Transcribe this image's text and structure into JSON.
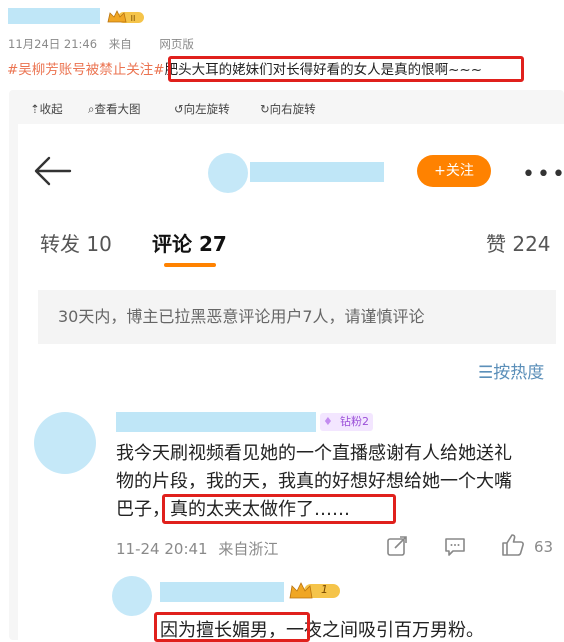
{
  "post": {
    "date": "11月24日 21:46",
    "source": "来自",
    "platform": "网页版",
    "hashtag": "#吴柳芳账号被禁止关注#",
    "text": "肥头大耳的姥妹们对长得好看的女人是真的恨啊~~~"
  },
  "toolbar": {
    "collapse": "收起",
    "view_large": "查看大图",
    "rotate_left": "向左旋转",
    "rotate_right": "向右旋转"
  },
  "screenshot": {
    "follow_label": "+关注",
    "tabs": [
      {
        "label": "转发 10"
      },
      {
        "label": "评论 27"
      },
      {
        "label": "赞 224"
      }
    ],
    "notice": "30天内，博主已拉黑恶意评论用户7人，请谨慎评论",
    "sort_label": "按热度",
    "comment": {
      "badge": "钻粉2",
      "text_line1": "我今天刷视频看见她的一个直播感谢有人给她送礼",
      "text_line2": "物的片段，我的天，我真的好想好想给她一个大嘴",
      "text_line3_pre": "巴子，",
      "text_line3_highlight": "真的太夹太做作了……",
      "timestamp": "11-24 20:41",
      "location": "来自浙江",
      "like_count": "63"
    },
    "reply": {
      "badge_level": "1",
      "text_highlight": "因为擅长媚男，",
      "text_rest": "一夜之间吸引百万男粉。"
    }
  },
  "colors": {
    "accent_orange": "#ff8200",
    "highlight_red": "#e0201c",
    "hashtag_orange": "#eb7350",
    "sort_blue": "#5b8fb9"
  }
}
